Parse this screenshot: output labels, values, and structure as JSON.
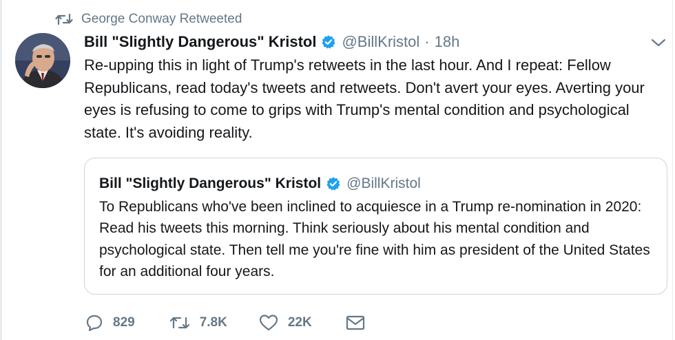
{
  "retweet_context": {
    "label": "George Conway Retweeted",
    "icon": "retweet-icon"
  },
  "tweet": {
    "display_name": "Bill \"Slightly Dangerous\" Kristol",
    "handle": "@BillKristol",
    "separator": "·",
    "timestamp": "18h",
    "text": "Re-upping this in light of Trump's retweets in the last hour. And I repeat: Fellow Republicans, read today's tweets and retweets. Don't avert your eyes. Averting your eyes is refusing to come to grips with Trump's mental condition and psychological state. It's avoiding reality."
  },
  "quoted_tweet": {
    "display_name": "Bill \"Slightly Dangerous\" Kristol",
    "handle": "@BillKristol",
    "text": "To Republicans who've been inclined to acquiesce in a Trump re-nomination in 2020: Read his tweets this morning. Think seriously about his mental condition and psychological state. Then tell me you're fine with him as president of the United States for an additional four years."
  },
  "actions": {
    "replies": "829",
    "retweets": "7.8K",
    "likes": "22K"
  },
  "colors": {
    "text": "#14171a",
    "muted": "#657786",
    "verified": "#1da1f2",
    "border": "#ccd6dd"
  }
}
